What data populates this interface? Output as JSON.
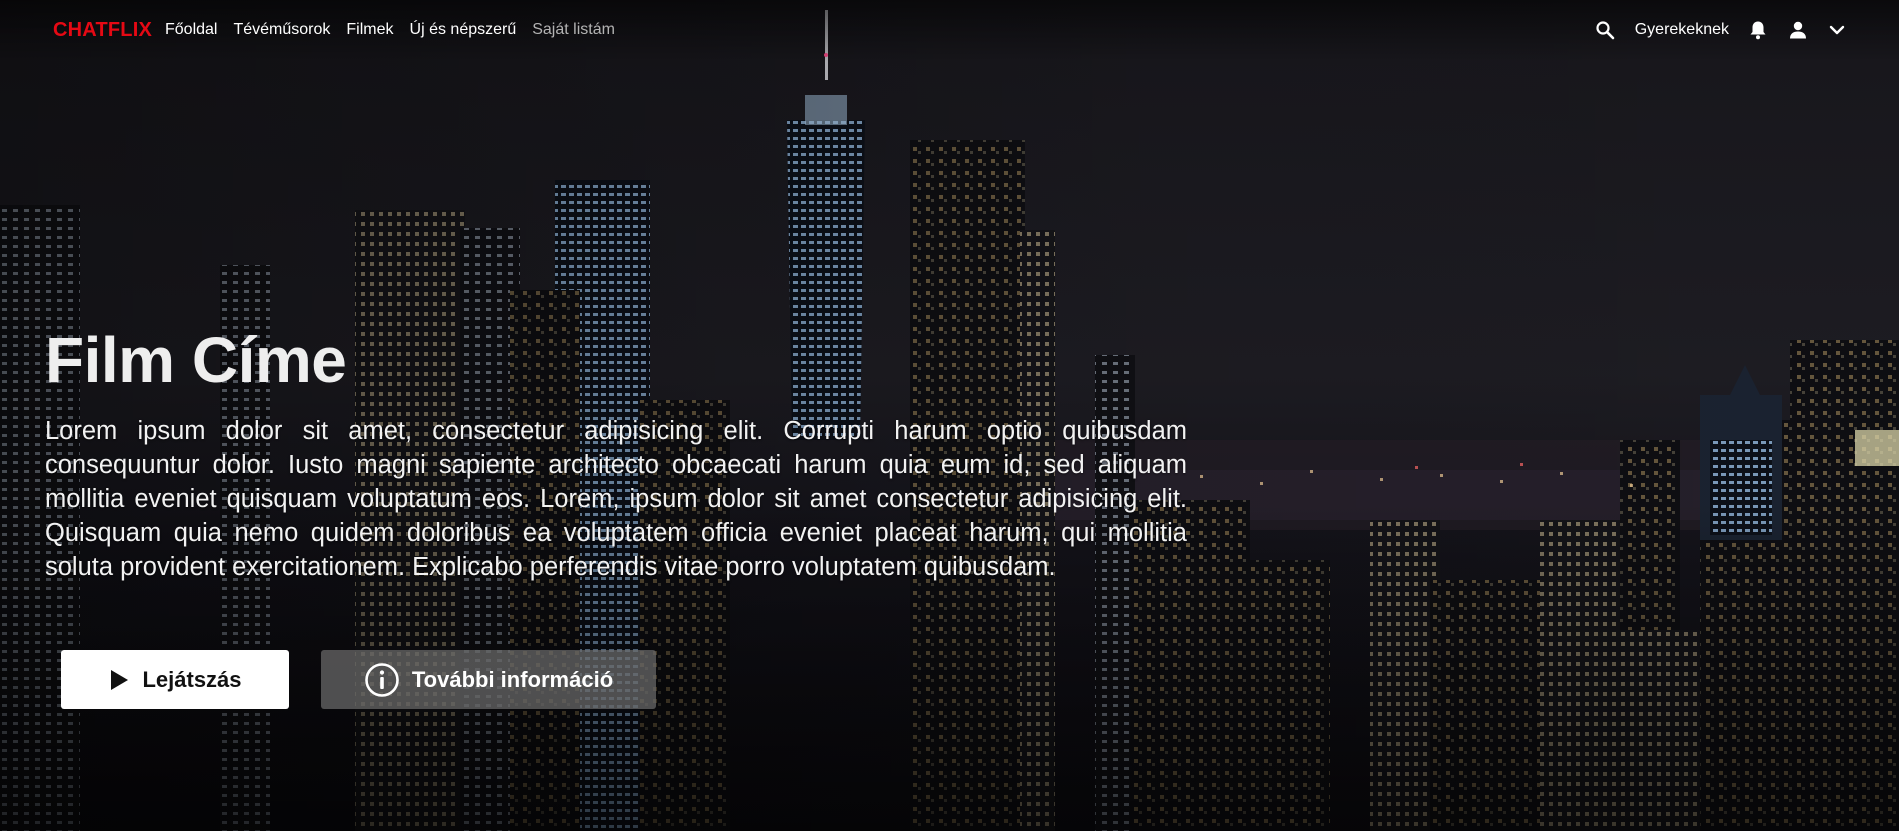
{
  "header": {
    "logo": "CHATFLIX",
    "nav": [
      {
        "label": "Főoldal",
        "active": true
      },
      {
        "label": "Tévéműsorok",
        "active": false
      },
      {
        "label": "Filmek",
        "active": false
      },
      {
        "label": "Új és népszerű",
        "active": false
      },
      {
        "label": "Saját listám",
        "active": false
      }
    ],
    "kids_label": "Gyerekeknek",
    "icons": [
      "search-icon",
      "bell-icon",
      "profile-icon",
      "chevron-down-icon"
    ]
  },
  "hero": {
    "title": "Film Címe",
    "description": "Lorem ipsum dolor sit amet, consectetur adipisicing elit. Corrupti harum optio quibusdam consequuntur dolor. Iusto magni sapiente architecto obcaecati harum quia eum id, sed aliquam mollitia eveniet quisquam voluptatum eos. Lorem, ipsum dolor sit amet consectetur adipisicing elit. Quisquam quia nemo quidem doloribus ea voluptatem officia eveniet placeat harum, qui mollitia soluta provident exercitationem. Explicabo perferendis vitae porro voluptatem quibusdam.",
    "play_label": "Lejátszás",
    "info_label": "További információ"
  },
  "colors": {
    "brand": "#e50914",
    "nav_text": "#ffffff",
    "nav_muted": "#b3b3b3",
    "play_bg": "#ffffff",
    "info_bg": "#6d6d6e"
  }
}
